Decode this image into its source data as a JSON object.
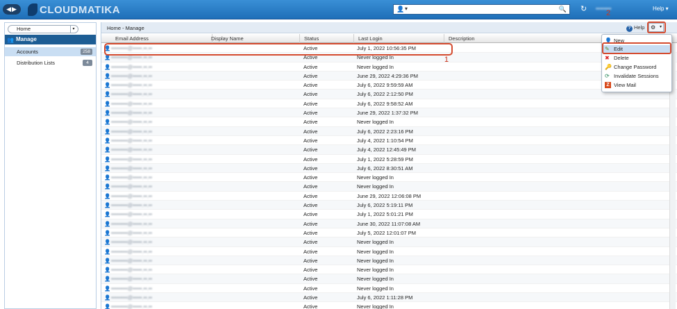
{
  "topbar": {
    "nav_glyph": "◀▶",
    "logo_text": "CLOUDMATIKA",
    "search_user_glyph": "👤",
    "search_dd_glyph": "▾",
    "search_placeholder": "",
    "search_glyph": "🔍",
    "refresh_glyph": "↻",
    "user_name": "••••••••",
    "help_label": "Help ▾"
  },
  "sidebar": {
    "home_label": "Home",
    "home_arrow": "▾",
    "manage_label": "Manage",
    "manage_glyph": "👥",
    "items": [
      {
        "label": "Accounts",
        "count": "258"
      },
      {
        "label": "Distribution Lists",
        "count": "4"
      }
    ]
  },
  "main": {
    "breadcrumb": "Home - Manage",
    "help_q": "?",
    "help_label": "Help",
    "gear_glyph": "⚙",
    "gear_dd": "▾",
    "columns": [
      "Email Address",
      "Display Name",
      "Status",
      "Last Login",
      "Description"
    ],
    "user_glyph": "👤",
    "rows": [
      {
        "email": "•••••••••@•••••.••.••",
        "status": "Active",
        "login": "July 1, 2022 10:56:35 PM"
      },
      {
        "email": "•••••••••@•••••.••.••",
        "status": "Active",
        "login": "Never logged In"
      },
      {
        "email": "•••••••••@•••••.••.••",
        "status": "Active",
        "login": "Never logged In"
      },
      {
        "email": "•••••••••@•••••.••.••",
        "status": "Active",
        "login": "June 29, 2022 4:29:36 PM"
      },
      {
        "email": "•••••••••@•••••.••.••",
        "status": "Active",
        "login": "July 6, 2022 9:59:59 AM"
      },
      {
        "email": "•••••••••@•••••.••.••",
        "status": "Active",
        "login": "July 6, 2022 2:12:50 PM"
      },
      {
        "email": "•••••••••@•••••.••.••",
        "status": "Active",
        "login": "July 6, 2022 9:58:52 AM"
      },
      {
        "email": "•••••••••@•••••.••.••",
        "status": "Active",
        "login": "June 29, 2022 1:37:32 PM"
      },
      {
        "email": "•••••••••@•••••.••.••",
        "status": "Active",
        "login": "Never logged In"
      },
      {
        "email": "•••••••••@•••••.••.••",
        "status": "Active",
        "login": "July 6, 2022 2:23:16 PM"
      },
      {
        "email": "•••••••••@•••••.••.••",
        "status": "Active",
        "login": "July 4, 2022 1:10:54 PM"
      },
      {
        "email": "•••••••••@•••••.••.••",
        "status": "Active",
        "login": "July 4, 2022 12:45:49 PM"
      },
      {
        "email": "•••••••••@•••••.••.••",
        "status": "Active",
        "login": "July 1, 2022 5:28:59 PM"
      },
      {
        "email": "•••••••••@•••••.••.••",
        "status": "Active",
        "login": "July 6, 2022 8:30:51 AM"
      },
      {
        "email": "•••••••••@•••••.••.••",
        "status": "Active",
        "login": "Never logged In"
      },
      {
        "email": "•••••••••@•••••.••.••",
        "status": "Active",
        "login": "Never logged In"
      },
      {
        "email": "•••••••••@•••••.••.••",
        "status": "Active",
        "login": "June 29, 2022 12:06:08 PM"
      },
      {
        "email": "•••••••••@•••••.••.••",
        "status": "Active",
        "login": "July 6, 2022 5:19:11 PM"
      },
      {
        "email": "•••••••••@•••••.••.••",
        "status": "Active",
        "login": "July 1, 2022 5:01:21 PM"
      },
      {
        "email": "•••••••••@•••••.••.••",
        "status": "Active",
        "login": "June 30, 2022 11:07:08 AM"
      },
      {
        "email": "•••••••••@•••••.••.••",
        "status": "Active",
        "login": "July 5, 2022 12:01:07 PM"
      },
      {
        "email": "•••••••••@•••••.••.••",
        "status": "Active",
        "login": "Never logged In"
      },
      {
        "email": "•••••••••@•••••.••.••",
        "status": "Active",
        "login": "Never logged In"
      },
      {
        "email": "•••••••••@•••••.••.••",
        "status": "Active",
        "login": "Never logged In"
      },
      {
        "email": "•••••••••@•••••.••.••",
        "status": "Active",
        "login": "Never logged In"
      },
      {
        "email": "•••••••••@•••••.••.••",
        "status": "Active",
        "login": "Never logged In"
      },
      {
        "email": "•••••••••@•••••.••.••",
        "status": "Active",
        "login": "Never logged In"
      },
      {
        "email": "•••••••••@•••••.••.••",
        "status": "Active",
        "login": "July 6, 2022 1:11:28 PM"
      },
      {
        "email": "•••••••••@•••••.••.••",
        "status": "Active",
        "login": "Never logged In"
      }
    ]
  },
  "menu": {
    "items": [
      {
        "label": "New",
        "glyph": "👤"
      },
      {
        "label": "Edit",
        "glyph": "✎"
      },
      {
        "label": "Delete",
        "glyph": "✖"
      },
      {
        "label": "Change Password",
        "glyph": "🔑"
      },
      {
        "label": "Invalidate Sessions",
        "glyph": "⟳"
      },
      {
        "label": "View Mail",
        "glyph": "Z"
      }
    ]
  },
  "annotations": {
    "row_marker": "1",
    "gear_marker": "2"
  },
  "colors": {
    "accent": "#1f6fb8",
    "highlight": "#d44a2e",
    "selected": "#c9def3"
  }
}
